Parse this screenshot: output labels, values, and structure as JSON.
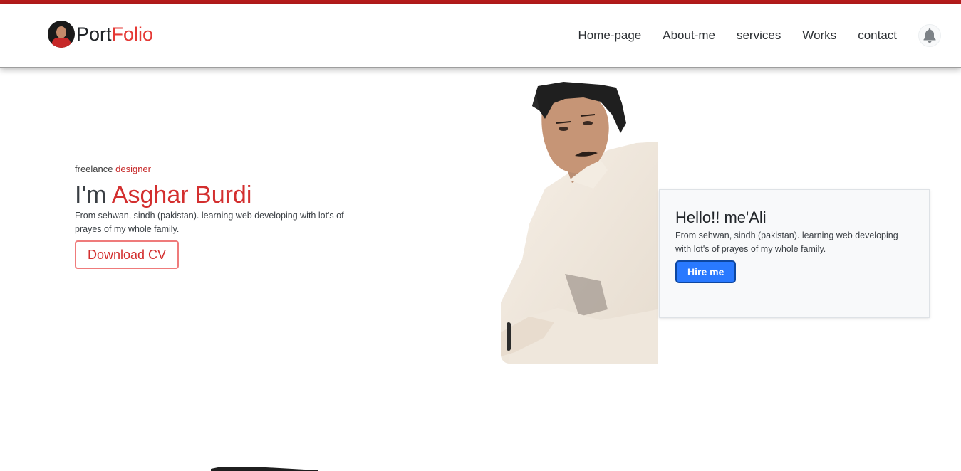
{
  "brand": {
    "port": "Port",
    "folio": "Folio"
  },
  "nav": {
    "items": [
      {
        "label": "Home-page"
      },
      {
        "label": "About-me"
      },
      {
        "label": "services"
      },
      {
        "label": "Works"
      },
      {
        "label": "contact"
      }
    ],
    "bell_icon": "bell-icon"
  },
  "hero": {
    "tagline_prefix": "freelance",
    "tagline_accent": "designer",
    "title_prefix": "I'm",
    "title_name": "Asghar Burdi",
    "description": "From sehwan, sindh (pakistan). learning web developing with lot's of prayes of my whole family.",
    "download_label": "Download CV"
  },
  "card": {
    "title": "Hello!! me'Ali",
    "text": "From sehwan, sindh (pakistan). learning web developing with lot's of prayes of my whole family.",
    "hire_label": "Hire me"
  },
  "colors": {
    "accent_red": "#d32f2f",
    "top_strip": "#b71c1c",
    "hire_blue": "#2979ff"
  }
}
